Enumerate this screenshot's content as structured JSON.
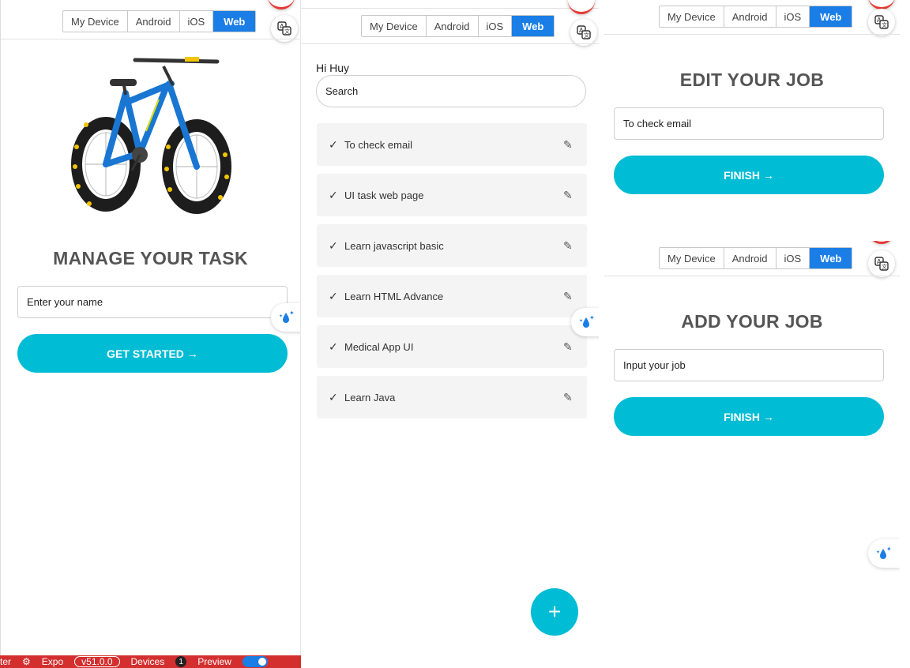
{
  "platform_tabs": [
    "My Device",
    "Android",
    "iOS",
    "Web"
  ],
  "translate_icon": "translate-icon",
  "drop_icon": "sparkle-drop-icon",
  "screen1": {
    "image": "bicycle-image",
    "title": "MANAGE YOUR TASK",
    "name_placeholder": "Enter your name",
    "cta_label": "GET STARTED →"
  },
  "screen2": {
    "greeting": "Hi Huy",
    "search_placeholder": "Search",
    "tasks": [
      {
        "check": "✓",
        "label": "To check email",
        "edit": "✎"
      },
      {
        "check": "✓",
        "label": "UI task web page",
        "edit": "✎"
      },
      {
        "check": "✓",
        "label": "Learn javascript basic",
        "edit": "✎"
      },
      {
        "check": "✓",
        "label": "Learn HTML Advance",
        "edit": "✎"
      },
      {
        "check": "✓",
        "label": "Medical App UI",
        "edit": "✎"
      },
      {
        "check": "✓",
        "label": "Learn Java",
        "edit": "✎"
      }
    ],
    "fab_label": "+"
  },
  "screen3": {
    "title": "EDIT YOUR JOB",
    "job_value": "To check email",
    "cta_label": "FINISH →"
  },
  "screen4": {
    "title": "ADD YOUR JOB",
    "job_placeholder": "Input your job",
    "cta_label": "FINISH →"
  },
  "dev_toolbar": {
    "left_text": "ter",
    "gear_icon": "gear-icon",
    "expo_label": "Expo",
    "version": "v51.0.0",
    "devices_label": "Devices",
    "devices_count": "1",
    "preview_label": "Preview"
  },
  "colors": {
    "accent": "#00bcd4",
    "active_tab": "#1a7ee6",
    "task_bg": "#f4f4f4",
    "dev_bar": "#d32f2f"
  }
}
